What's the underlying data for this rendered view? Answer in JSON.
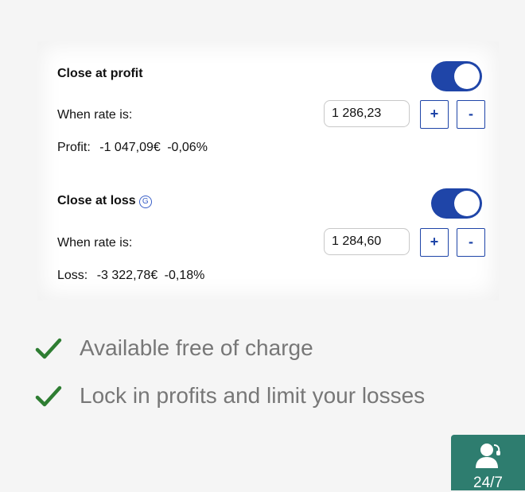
{
  "close_at_profit": {
    "title": "Close at profit",
    "toggle_on": true,
    "rate_label": "When rate is:",
    "rate_value": "1 286,23",
    "plus_label": "+",
    "minus_label": "-",
    "result_label": "Profit:",
    "result_amount": "-1 047,09€",
    "result_percent": "-0,06%"
  },
  "close_at_loss": {
    "title": "Close at loss",
    "guarantee_icon": "G",
    "toggle_on": true,
    "rate_label": "When rate is:",
    "rate_value": "1 284,60",
    "plus_label": "+",
    "minus_label": "-",
    "result_label": "Loss:",
    "result_amount": "-3 322,78€",
    "result_percent": "-0,18%"
  },
  "benefits": [
    {
      "icon": "checkmark-icon",
      "text": "Available free of charge"
    },
    {
      "icon": "checkmark-icon",
      "text": "Lock in profits and limit your losses"
    }
  ],
  "support_widget": {
    "icon": "support-person-icon",
    "label": "24/7"
  },
  "colors": {
    "accent": "#1f45a8",
    "check": "#2e7d32",
    "support_bg": "#2e7d6f"
  }
}
